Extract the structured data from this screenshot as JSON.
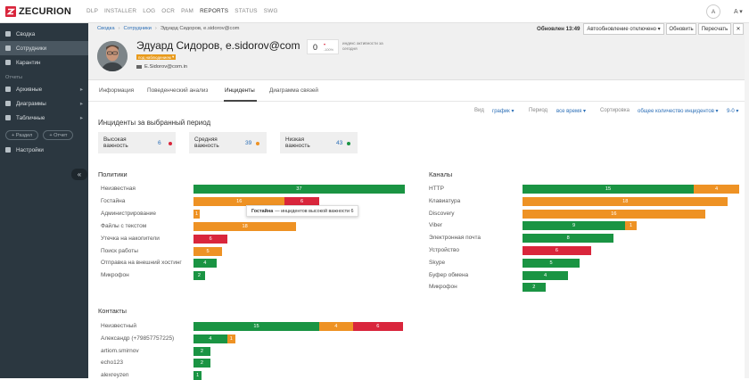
{
  "app": {
    "logo": "ZECURION",
    "nav": [
      "DLP",
      "INSTALLER",
      "LOG",
      "OCR",
      "PAM",
      "REPORTS",
      "STATUS",
      "SWG"
    ],
    "active_nav": "REPORTS",
    "user_initial": "A",
    "user_menu": "A",
    "brand_color": "#d9263c"
  },
  "sidebar": {
    "items_top": [
      {
        "label": "Сводка",
        "icon": "dashboard-icon"
      },
      {
        "label": "Сотрудники",
        "icon": "user-icon",
        "active": true
      },
      {
        "label": "Карантин",
        "icon": "quarantine-icon"
      }
    ],
    "section_label": "Отчеты",
    "items_reports": [
      {
        "label": "Архивные",
        "icon": "archive-icon"
      },
      {
        "label": "Диаграммы",
        "icon": "chart-icon"
      },
      {
        "label": "Табличные",
        "icon": "table-icon"
      }
    ],
    "add_section": "+ Раздел",
    "add_report": "+ Отчет",
    "settings": "Настройки",
    "collapse": "«"
  },
  "header": {
    "breadcrumb": [
      "Сводка",
      "Сотрудники",
      "Эдуард Сидоров, e.sidorov@com"
    ],
    "updated": "Обновлен 13:49",
    "autoupdate": "Автообновление отключено",
    "refresh": "Обновить",
    "recalc": "Пересчать",
    "person_name": "Эдуард Сидоров, e.sidorov@com",
    "watch_badge": "под наблюдением",
    "email": "E.Sidorov@com.in",
    "activity_value": "0",
    "activity_delta": "▾",
    "activity_delta_pct": "-100%",
    "activity_label": "индекс активности за сегодня"
  },
  "tabs": [
    "Информация",
    "Поведенческий анализ",
    "Инциденты",
    "Диаграмма связей"
  ],
  "active_tab": "Инциденты",
  "controls": {
    "view_label": "Вид",
    "view_value": "график",
    "period_label": "Период",
    "period_value": "все время",
    "sort_label": "Сортировка",
    "sort_value": "общее количество инцидентов",
    "sort_dir": "9-0"
  },
  "period_title": "Инциденты за выбранный период",
  "severity": [
    {
      "label_lines": [
        "Высокая",
        "важность"
      ],
      "count": "6",
      "color": "#d9263c"
    },
    {
      "label_lines": [
        "Средняя",
        "важность"
      ],
      "count": "39",
      "color": "#ee9224"
    },
    {
      "label_lines": [
        "Низкая",
        "важность"
      ],
      "count": "43",
      "color": "#1a9443"
    }
  ],
  "colors": {
    "low": "#1a9443",
    "medium": "#ee9224",
    "high": "#d9263c"
  },
  "tooltip": {
    "bold": "Гостайна",
    "text": "— инцидентов высокой важности 6"
  },
  "sections": {
    "policies": {
      "title": "Политики",
      "rows": [
        {
          "label": "Неизвестная",
          "low": 37,
          "medium": 0,
          "high": 0
        },
        {
          "label": "Гостайна",
          "low": 0,
          "medium": 16,
          "high": 6
        },
        {
          "label": "Администрирование",
          "low": 0,
          "medium": 1,
          "high": 0
        },
        {
          "label": "Файлы с текстом",
          "low": 0,
          "medium": 18,
          "high": 0
        },
        {
          "label": "Утечка на накопители",
          "low": 0,
          "medium": 0,
          "high": 6
        },
        {
          "label": "Поиск работы",
          "low": 0,
          "medium": 5,
          "high": 0
        },
        {
          "label": "Отправка на внешний хостинг",
          "low": 4,
          "medium": 0,
          "high": 0
        },
        {
          "label": "Микрофон",
          "low": 2,
          "medium": 0,
          "high": 0
        }
      ]
    },
    "channels": {
      "title": "Каналы",
      "rows": [
        {
          "label": "HTTP",
          "low": 15,
          "medium": 4,
          "high": 0
        },
        {
          "label": "Клавиатура",
          "low": 0,
          "medium": 18,
          "high": 0
        },
        {
          "label": "Discovery",
          "low": 0,
          "medium": 16,
          "high": 0
        },
        {
          "label": "Viber",
          "low": 9,
          "medium": 1,
          "high": 0
        },
        {
          "label": "Электронная почта",
          "low": 8,
          "medium": 0,
          "high": 0
        },
        {
          "label": "Устройство",
          "low": 0,
          "medium": 0,
          "high": 6
        },
        {
          "label": "Skype",
          "low": 5,
          "medium": 0,
          "high": 0
        },
        {
          "label": "Буфер обмена",
          "low": 4,
          "medium": 0,
          "high": 0
        },
        {
          "label": "Микрофон",
          "low": 2,
          "medium": 0,
          "high": 0
        }
      ]
    },
    "contacts": {
      "title": "Контакты",
      "rows": [
        {
          "label": "Неизвестный",
          "low": 15,
          "medium": 4,
          "high": 6
        },
        {
          "label": "Александр (+79857757225)",
          "low": 4,
          "medium": 1,
          "high": 0
        },
        {
          "label": "artiom.smirnov",
          "low": 2,
          "medium": 0,
          "high": 0
        },
        {
          "label": "echo123",
          "low": 2,
          "medium": 0,
          "high": 0
        },
        {
          "label": "alexreyzen",
          "low": 1,
          "medium": 0,
          "high": 0
        }
      ]
    }
  }
}
